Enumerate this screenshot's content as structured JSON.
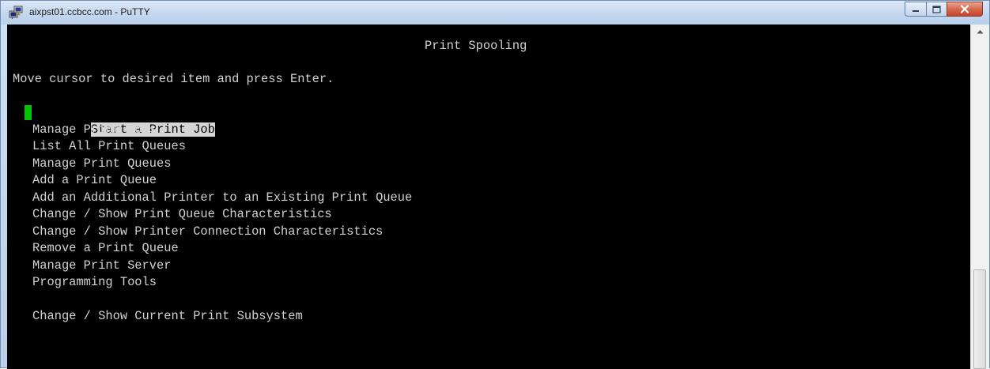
{
  "window": {
    "title": "aixpst01.ccbcc.com - PuTTY",
    "icons": {
      "app": "putty-icon",
      "minimize": "minimize-icon",
      "maximize": "maximize-icon",
      "close": "close-icon"
    }
  },
  "terminal": {
    "screen_title": "Print Spooling",
    "instruction": "Move cursor to desired item and press Enter.",
    "selected_index": 0,
    "cursor_color": "#00c400",
    "menu": [
      "Start a Print Job",
      "Manage Print Jobs",
      "List All Print Queues",
      "Manage Print Queues",
      "Add a Print Queue",
      "Add an Additional Printer to an Existing Print Queue",
      "Change / Show Print Queue Characteristics",
      "Change / Show Printer Connection Characteristics",
      "Remove a Print Queue",
      "Manage Print Server",
      "Programming Tools",
      "Change / Show Current Print Subsystem"
    ]
  },
  "scrollbar": {
    "up_icon": "scroll-up-arrow-icon"
  }
}
